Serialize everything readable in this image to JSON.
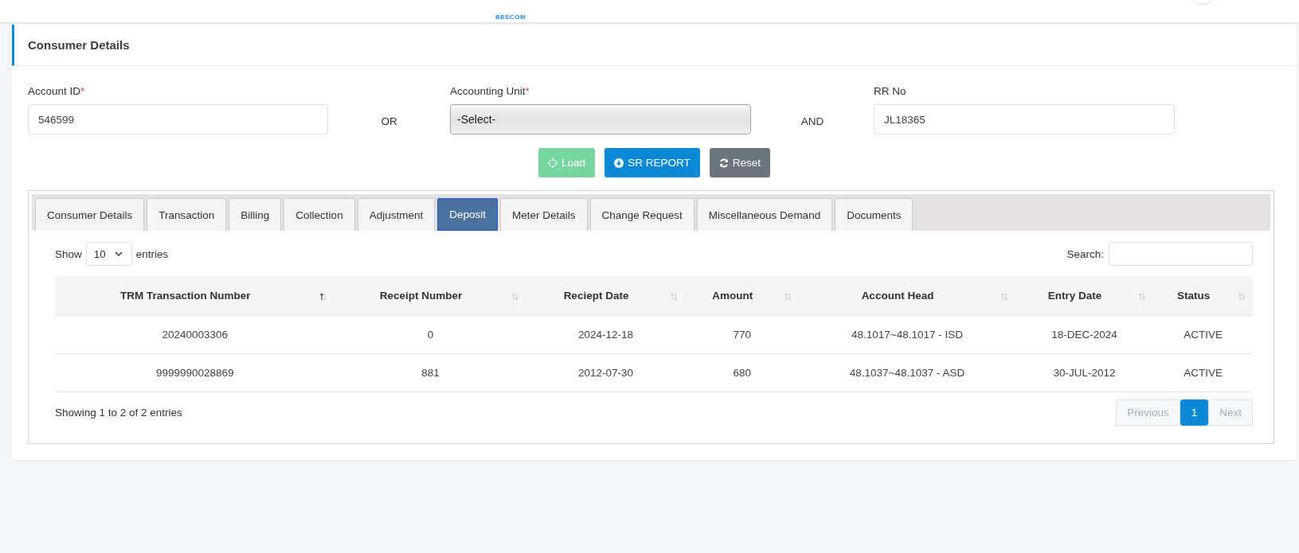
{
  "header": {
    "logo": "BESCOM"
  },
  "card": {
    "title": "Consumer Details"
  },
  "form": {
    "fields": [
      {
        "kind": "input",
        "label": "Account ID",
        "required_mark": "*",
        "value": "546599"
      },
      {
        "kind": "select",
        "label": "Accounting Unit",
        "required_mark": "*",
        "value": "-Select-"
      },
      {
        "kind": "input",
        "label": "RR No",
        "value": "JL18365"
      }
    ],
    "separators": [
      "OR",
      "AND"
    ]
  },
  "buttons": [
    {
      "kind": "load",
      "label": "Load",
      "disabled": true
    },
    {
      "kind": "report",
      "label": "SR REPORT",
      "disabled": false
    },
    {
      "kind": "reset",
      "label": "Reset",
      "disabled": false
    }
  ],
  "tabs": [
    {
      "label": "Consumer Details",
      "selected": false
    },
    {
      "label": "Transaction",
      "selected": false
    },
    {
      "label": "Billing",
      "selected": false
    },
    {
      "label": "Collection",
      "selected": false
    },
    {
      "label": "Adjustment",
      "selected": false
    },
    {
      "label": "Deposit",
      "selected": true
    },
    {
      "label": "Meter Details",
      "selected": false
    },
    {
      "label": "Change Request",
      "selected": false
    },
    {
      "label": "Miscellaneous Demand",
      "selected": false
    },
    {
      "label": "Documents",
      "selected": false
    }
  ],
  "length_menu": {
    "before": "Show",
    "value": "10",
    "after": "entries"
  },
  "search": {
    "label": "Search:"
  },
  "table": {
    "columns": [
      {
        "label": "TRM Transaction Number",
        "sorted": true
      },
      {
        "label": "Receipt Number",
        "sorted": false
      },
      {
        "label": "Reciept Date",
        "sorted": false
      },
      {
        "label": "Amount",
        "sorted": false
      },
      {
        "label": "Account Head",
        "sorted": false
      },
      {
        "label": "Entry Date",
        "sorted": false
      },
      {
        "label": "Status",
        "sorted": false
      }
    ],
    "rows": [
      [
        "20240003306",
        "0",
        "2024-12-18",
        "770",
        "48.1017~48.1017 - ISD",
        "18-DEC-2024",
        "ACTIVE"
      ],
      [
        "9999990028869",
        "881",
        "2012-07-30",
        "680",
        "48.1037~48.1037 - ASD",
        "30-JUL-2012",
        "ACTIVE"
      ]
    ]
  },
  "info": "Showing 1 to 2 of 2 entries",
  "pagination": [
    {
      "label": "Previous",
      "selected": false,
      "disabled": true
    },
    {
      "label": "1",
      "selected": true,
      "disabled": false
    },
    {
      "label": "Next",
      "selected": false,
      "disabled": true
    }
  ]
}
